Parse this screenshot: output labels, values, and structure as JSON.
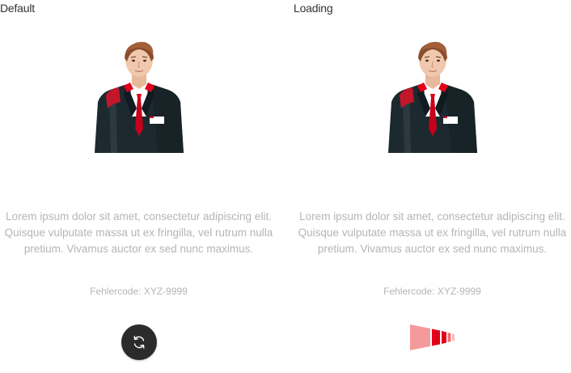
{
  "states": {
    "default": {
      "label": "Default",
      "message": "Lorem ipsum dolor sit amet, consectetur adipiscing elit. Quisque vulputate massa ut ex fringilla, vel rutrum nulla pretium. Vivamus auctor ex sed nunc maximus.",
      "error_code": "Fehlercode: XYZ-9999",
      "action_icon": "refresh-icon"
    },
    "loading": {
      "label": "Loading",
      "message": "Lorem ipsum dolor sit amet, consectetur adipiscing elit. Quisque vulputate massa ut ex fringilla, vel rutrum nulla pretium. Vivamus auctor ex sed nunc maximus.",
      "error_code": "Fehlercode: XYZ-9999",
      "action_icon": "loading-indicator-icon"
    }
  },
  "colors": {
    "brand_red": "#e2001a",
    "brand_red_light": "#f59a9a",
    "button_dark": "#2b2b2b",
    "text_muted": "#b5b5b5",
    "suit": "#1c2a30"
  }
}
